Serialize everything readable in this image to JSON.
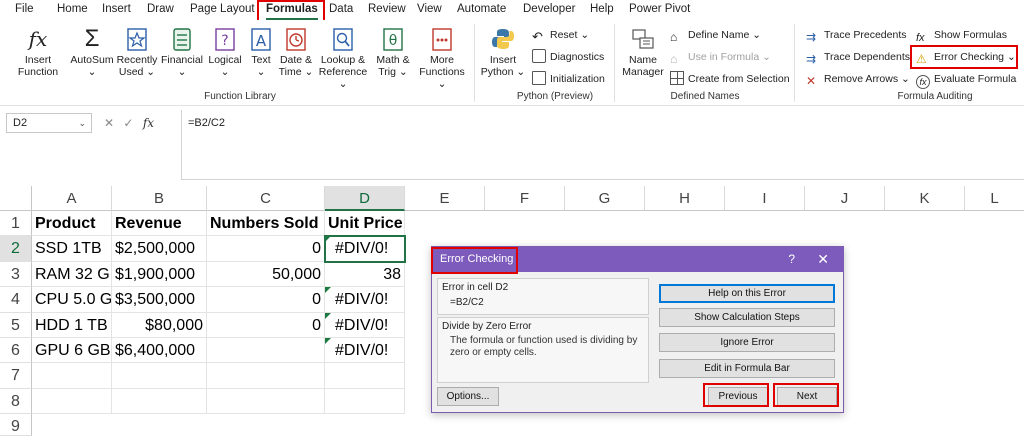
{
  "menu": {
    "tabs": [
      "File",
      "Home",
      "Insert",
      "Draw",
      "Page Layout",
      "Formulas",
      "Data",
      "Review",
      "View",
      "Automate",
      "Developer",
      "Help",
      "Power Pivot"
    ],
    "active": "Formulas"
  },
  "ribbon": {
    "function_library": {
      "group_label": "Function Library",
      "insert_function": [
        "Insert",
        "Function"
      ],
      "autosum": [
        "AutoSum",
        "⌄"
      ],
      "recently_used": [
        "Recently",
        "Used ⌄"
      ],
      "financial": [
        "Financial",
        "⌄"
      ],
      "logical": [
        "Logical",
        "⌄"
      ],
      "text": [
        "Text",
        "⌄"
      ],
      "date_time": [
        "Date &",
        "Time ⌄"
      ],
      "lookup_reference": [
        "Lookup &",
        "Reference ⌄"
      ],
      "math_trig": [
        "Math &",
        "Trig ⌄"
      ],
      "more_functions": [
        "More",
        "Functions ⌄"
      ]
    },
    "python": {
      "group_label": "Python (Preview)",
      "insert_python": [
        "Insert",
        "Python ⌄"
      ],
      "reset": "Reset ⌄",
      "diagnostics": "Diagnostics",
      "initialization": "Initialization"
    },
    "defined_names": {
      "group_label": "Defined Names",
      "name_manager": [
        "Name",
        "Manager"
      ],
      "define_name": "Define Name ⌄",
      "use_in_formula": "Use in Formula ⌄",
      "create_from_selection": "Create from Selection"
    },
    "formula_auditing": {
      "group_label": "Formula Auditing",
      "trace_precedents": "Trace Precedents",
      "trace_dependents": "Trace Dependents",
      "remove_arrows": "Remove Arrows ⌄",
      "show_formulas": "Show Formulas",
      "error_checking": "Error Checking ⌄",
      "evaluate_formula": "Evaluate Formula"
    }
  },
  "formula_bar": {
    "name_box": "D2",
    "formula": "=B2/C2",
    "fx": "fx"
  },
  "sheet": {
    "columns": [
      "A",
      "B",
      "C",
      "D",
      "E",
      "F",
      "G",
      "H",
      "I",
      "J",
      "K",
      "L"
    ],
    "rows": [
      "1",
      "2",
      "3",
      "4",
      "5",
      "6",
      "7",
      "8",
      "9"
    ],
    "header": [
      "Product",
      "Revenue",
      "Numbers Sold",
      "Unit Price"
    ],
    "data": [
      [
        "SSD 1TB",
        "$2,500,000",
        "0",
        "#DIV/0!"
      ],
      [
        "RAM 32 G",
        "$1,900,000",
        "50,000",
        "38"
      ],
      [
        "CPU 5.0 G",
        "$3,500,000",
        "0",
        "#DIV/0!"
      ],
      [
        "HDD 1 TB",
        "$80,000",
        "0",
        "#DIV/0!"
      ],
      [
        "GPU 6 GB",
        "$6,400,000",
        "",
        "#DIV/0!"
      ]
    ],
    "active_cell": "D2"
  },
  "dialog": {
    "title": "Error Checking",
    "help_glyph": "?",
    "close_glyph": "✕",
    "error_in_cell": "Error in cell D2",
    "formula": "=B2/C2",
    "error_type": "Divide by Zero Error",
    "description": "The formula or function used is dividing by zero or empty cells.",
    "buttons": {
      "help": "Help on this Error",
      "show_steps": "Show Calculation Steps",
      "ignore": "Ignore Error",
      "edit": "Edit in Formula Bar",
      "options": "Options...",
      "previous": "Previous",
      "next": "Next"
    }
  },
  "colors": {
    "excel_green": "#217346",
    "dialog_title": "#7d5bbd",
    "highlight_red": "#e00000"
  }
}
